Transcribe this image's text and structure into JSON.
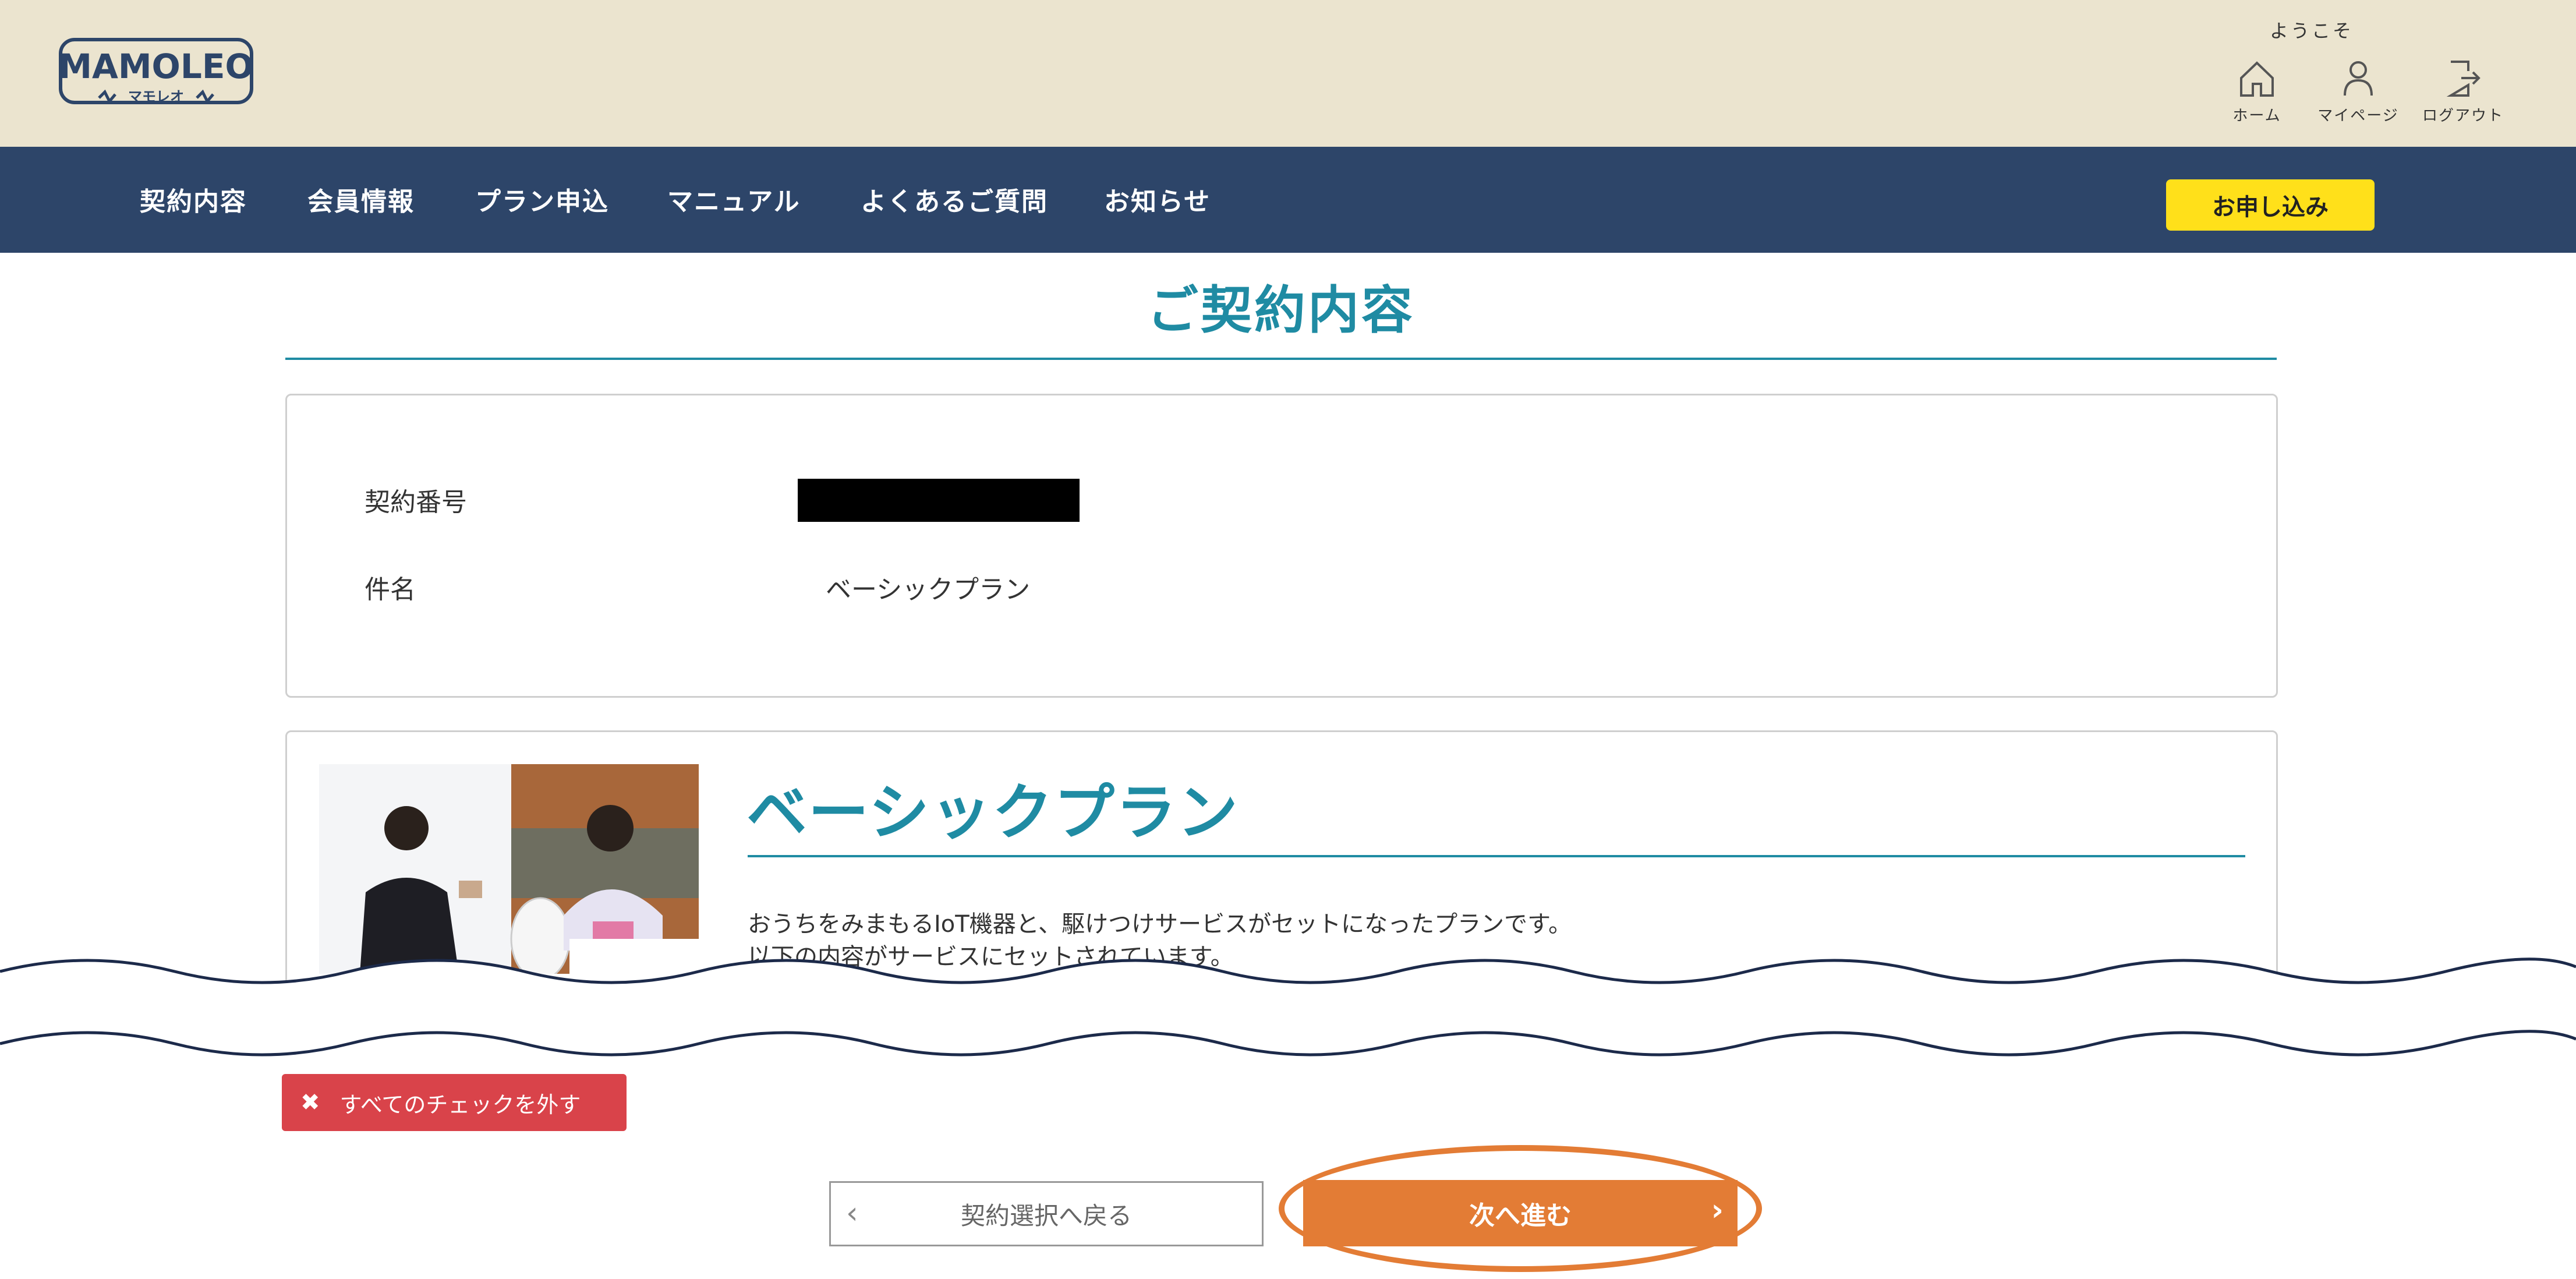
{
  "header": {
    "logo_text": "MAMOLEO",
    "logo_sub": "マモレオ",
    "welcome": "ようこそ",
    "nav": [
      {
        "label": "ホーム",
        "icon": "home-icon"
      },
      {
        "label": "マイページ",
        "icon": "user-icon"
      },
      {
        "label": "ログアウト",
        "icon": "logout-icon"
      }
    ]
  },
  "menu": {
    "items": [
      "契約内容",
      "会員情報",
      "プラン申込",
      "マニュアル",
      "よくあるご質問",
      "お知らせ"
    ],
    "apply_label": "お申し込み"
  },
  "page": {
    "title": "ご契約内容"
  },
  "contract": {
    "number_label": "契約番号",
    "name_label": "件名",
    "name_value": "ベーシックプラン"
  },
  "plan": {
    "title": "ベーシックプラン",
    "desc_line1": "おうちをみまもるIoT機器と、駆けつけサービスがセットになったプランです。",
    "desc_line2": "以下の内容がサービスにセットされています。"
  },
  "actions": {
    "uncheck_all": "すべてのチェックを外す",
    "back": "契約選択へ戻る",
    "next": "次へ進む"
  },
  "colors": {
    "header_bg": "#ebe4cf",
    "nav_bg": "#2d4569",
    "accent_teal": "#1f8ba3",
    "apply_yellow": "#ffe01a",
    "next_orange": "#e37c35",
    "uncheck_red": "#d9434a"
  }
}
